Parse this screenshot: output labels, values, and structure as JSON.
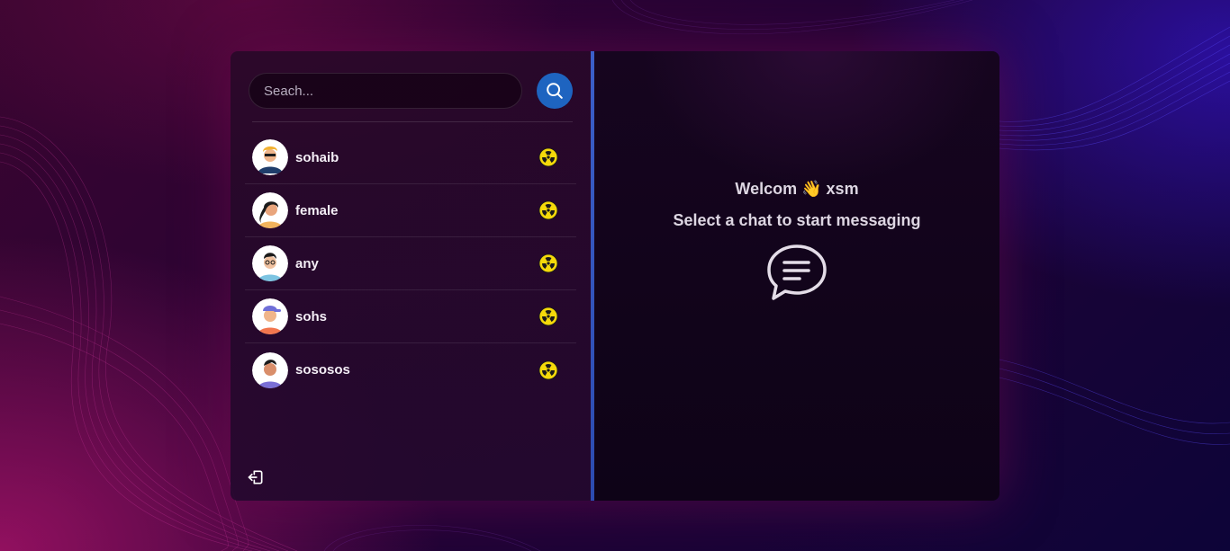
{
  "sidebar": {
    "search": {
      "placeholder": "Seach..."
    },
    "conversations": [
      {
        "name": "sohaib",
        "status_emoji": "☢"
      },
      {
        "name": "female",
        "status_emoji": "☢"
      },
      {
        "name": "any",
        "status_emoji": "☢"
      },
      {
        "name": "sohs",
        "status_emoji": "☢"
      },
      {
        "name": "sososos",
        "status_emoji": "☢"
      }
    ]
  },
  "main": {
    "welcome_prefix": "Welcom",
    "wave_emoji": "👋",
    "username": "xsm",
    "instruction": "Select a chat to start messaging"
  },
  "icons": {
    "search": "search-icon",
    "logout": "logout-icon",
    "chat": "chat-bubble-icon",
    "status": "radioactive-icon"
  },
  "colors": {
    "accent": "#1e64c0",
    "divider": "#3b5fc9",
    "status_yellow": "#f5d90a"
  }
}
